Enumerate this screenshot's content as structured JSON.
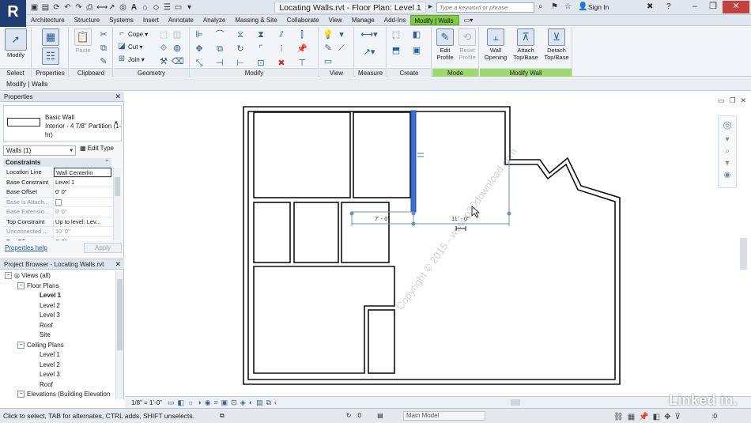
{
  "app": {
    "logo_letter": "R",
    "document_title": "Locating Walls.rvt - Floor Plan: Level 1",
    "search_placeholder": "Type a keyword or phrase",
    "sign_in": "Sign In",
    "quick_access_icons": [
      "open-icon",
      "save-icon",
      "sync-icon",
      "undo-icon",
      "redo-icon",
      "print-icon",
      "measure-icon",
      "dimension-icon",
      "tag-icon",
      "text-icon",
      "3d-view-icon",
      "section-icon",
      "thin-lines-icon",
      "close-hidden-icon",
      "switch-windows-icon"
    ]
  },
  "ribbon_tabs": [
    "Architecture",
    "Structure",
    "Systems",
    "Insert",
    "Annotate",
    "Analyze",
    "Massing & Site",
    "Collaborate",
    "View",
    "Manage",
    "Add-Ins"
  ],
  "context_tab": "Modify | Walls",
  "ribbon": {
    "select": {
      "button": "Modify",
      "label": "Select"
    },
    "properties": {
      "label": "Properties"
    },
    "clipboard": {
      "paste": "Paste",
      "label": "Clipboard"
    },
    "geometry": {
      "cope": "Cope",
      "cut": "Cut",
      "join": "Join",
      "label": "Geometry"
    },
    "modify": {
      "label": "Modify"
    },
    "view": {
      "label": "View"
    },
    "measure": {
      "label": "Measure"
    },
    "create": {
      "label": "Create"
    },
    "mode": {
      "edit_profile": "Edit Profile",
      "reset_profile": "Reset Profile",
      "label": "Mode"
    },
    "modify_wall": {
      "wall_opening": "Wall Opening",
      "attach": "Attach Top/Base",
      "detach": "Detach Top/Base",
      "label": "Modify Wall"
    }
  },
  "context_bar": "Modify | Walls",
  "properties_palette": {
    "title": "Properties",
    "type_family": "Basic Wall",
    "type_name": "Interior - 4 7/8\" Partition (1-hr)",
    "selector": "Walls (1)",
    "edit_type": "Edit Type",
    "group": "Constraints",
    "rows": [
      {
        "key": "Location Line",
        "value": "Wall Centerlin",
        "dim": false,
        "boxed": true
      },
      {
        "key": "Base Constraint",
        "value": "Level 1",
        "dim": false,
        "boxed": false
      },
      {
        "key": "Base Offset",
        "value": "0' 0\"",
        "dim": false,
        "boxed": false
      },
      {
        "key": "Base is Attach...",
        "value": "",
        "dim": true,
        "boxed": false,
        "checkbox": true
      },
      {
        "key": "Base Extensio...",
        "value": "0' 0\"",
        "dim": true,
        "boxed": false
      },
      {
        "key": "Top Constraint",
        "value": "Up to level: Lev...",
        "dim": false,
        "boxed": false
      },
      {
        "key": "Unconnected ...",
        "value": "10' 0\"",
        "dim": true,
        "boxed": false
      },
      {
        "key": "Top Offset",
        "value": "0' 0\"",
        "dim": false,
        "boxed": false
      }
    ],
    "help_link": "Properties help",
    "apply": "Apply"
  },
  "project_browser": {
    "title": "Project Browser - Locating Walls.rvt",
    "nodes": [
      {
        "label": "Views (all)",
        "indent": 0,
        "toggle": "-",
        "bold": false
      },
      {
        "label": "Floor Plans",
        "indent": 1,
        "toggle": "-",
        "bold": false
      },
      {
        "label": "Level 1",
        "indent": 2,
        "toggle": "",
        "bold": true
      },
      {
        "label": "Level 2",
        "indent": 2,
        "toggle": "",
        "bold": false
      },
      {
        "label": "Level 3",
        "indent": 2,
        "toggle": "",
        "bold": false
      },
      {
        "label": "Roof",
        "indent": 2,
        "toggle": "",
        "bold": false
      },
      {
        "label": "Site",
        "indent": 2,
        "toggle": "",
        "bold": false
      },
      {
        "label": "Ceiling Plans",
        "indent": 1,
        "toggle": "-",
        "bold": false
      },
      {
        "label": "Level 1",
        "indent": 2,
        "toggle": "",
        "bold": false
      },
      {
        "label": "Level 2",
        "indent": 2,
        "toggle": "",
        "bold": false
      },
      {
        "label": "Level 3",
        "indent": 2,
        "toggle": "",
        "bold": false
      },
      {
        "label": "Roof",
        "indent": 2,
        "toggle": "",
        "bold": false
      },
      {
        "label": "Elevations (Building Elevation",
        "indent": 1,
        "toggle": "-",
        "bold": false
      }
    ]
  },
  "canvas": {
    "dim_left": "7' - 0\"",
    "dim_right": "11' - 0\"",
    "watermark": "Copyright © 2015 - www.p30download.com",
    "wall_highlight_color": "#3a6fd8",
    "dim_color": "#6f8fc7"
  },
  "view_bar": {
    "scale": "1/8\" = 1'-0\""
  },
  "status_bar": {
    "text": "Click to select, TAB for alternates, CTRL adds, SHIFT unselects.",
    "count": ":0",
    "model": "Main Model",
    "filter": ":0"
  },
  "overlay": {
    "brand": "Linked in."
  }
}
